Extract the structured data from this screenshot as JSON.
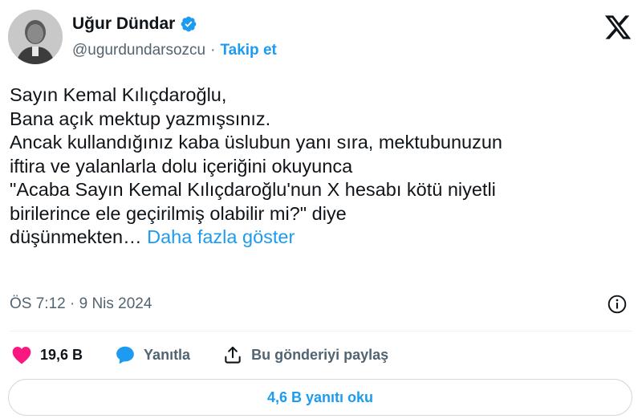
{
  "author": {
    "display_name": "Uğur Dündar",
    "handle": "@ugurdundarsozcu",
    "separator": "·",
    "follow_label": "Takip et",
    "verified": true
  },
  "icons": {
    "avatar": "avatar-photo",
    "verified": "verified-badge-icon",
    "platform": "x-logo-icon",
    "info": "info-icon",
    "like": "heart-icon",
    "reply": "speech-bubble-icon",
    "share": "share-icon"
  },
  "tweet": {
    "text": "Sayın Kemal Kılıçdaroğlu,\nBana açık mektup yazmışsınız.\nAncak kullandığınız kaba üslubun yanı sıra, mektubunuzun\niftira ve yalanlarla dolu içeriğini okuyunca\n\"Acaba Sayın Kemal Kılıçdaroğlu'nun X hesabı kötü niyetli\nbirilerince ele geçirilmiş olabilir mi?\" diye\ndüşünmekten… ",
    "show_more": "Daha fazla göster",
    "timestamp": "ÖS 7:12 · 9 Nis 2024"
  },
  "actions": {
    "likes": "19,6 B",
    "reply_label": "Yanıtla",
    "share_label": "Bu gönderiyi paylaş"
  },
  "replies_button": "4,6 B yanıtı oku",
  "colors": {
    "accent": "#1d9bf0",
    "like": "#f91880",
    "text": "#0f1419",
    "muted": "#536471"
  }
}
